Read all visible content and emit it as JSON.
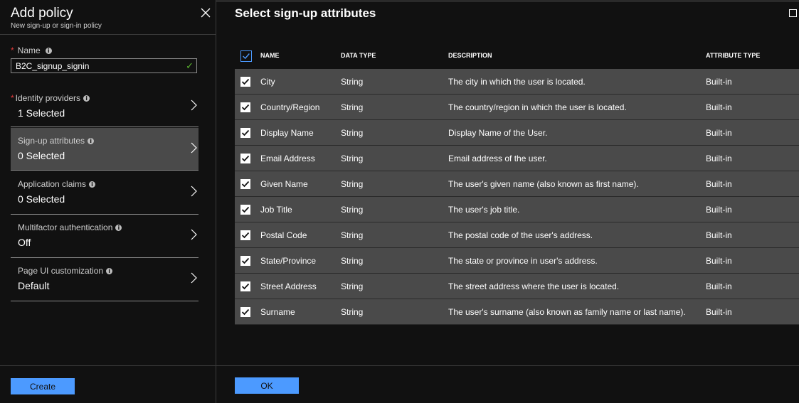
{
  "left": {
    "title": "Add policy",
    "subtitle": "New sign-up or sign-in policy",
    "name_label": "Name",
    "name_required": "*",
    "name_value": "B2C_signup_signin",
    "items": [
      {
        "label": "Identity providers",
        "value": "1 Selected",
        "required": "*"
      },
      {
        "label": "Sign-up attributes",
        "value": "0 Selected",
        "required": ""
      },
      {
        "label": "Application claims",
        "value": "0 Selected",
        "required": ""
      },
      {
        "label": "Multifactor authentication",
        "value": "Off",
        "required": ""
      },
      {
        "label": "Page UI customization",
        "value": "Default",
        "required": ""
      }
    ],
    "create_label": "Create"
  },
  "right": {
    "title": "Select sign-up attributes",
    "headers": {
      "name": "NAME",
      "type": "DATA TYPE",
      "desc": "DESCRIPTION",
      "attr": "ATTRIBUTE TYPE"
    },
    "rows": [
      {
        "name": "City",
        "type": "String",
        "desc": "The city in which the user is located.",
        "attr": "Built-in"
      },
      {
        "name": "Country/Region",
        "type": "String",
        "desc": "The country/region in which the user is located.",
        "attr": "Built-in"
      },
      {
        "name": "Display Name",
        "type": "String",
        "desc": "Display Name of the User.",
        "attr": "Built-in"
      },
      {
        "name": "Email Address",
        "type": "String",
        "desc": "Email address of the user.",
        "attr": "Built-in"
      },
      {
        "name": "Given Name",
        "type": "String",
        "desc": "The user's given name (also known as first name).",
        "attr": "Built-in"
      },
      {
        "name": "Job Title",
        "type": "String",
        "desc": "The user's job title.",
        "attr": "Built-in"
      },
      {
        "name": "Postal Code",
        "type": "String",
        "desc": "The postal code of the user's address.",
        "attr": "Built-in"
      },
      {
        "name": "State/Province",
        "type": "String",
        "desc": "The state or province in user's address.",
        "attr": "Built-in"
      },
      {
        "name": "Street Address",
        "type": "String",
        "desc": "The street address where the user is located.",
        "attr": "Built-in"
      },
      {
        "name": "Surname",
        "type": "String",
        "desc": "The user's surname (also known as family name or last name).",
        "attr": "Built-in"
      }
    ],
    "ok_label": "OK"
  },
  "colors": {
    "accent": "#4c9aff",
    "valid": "#5cb82f",
    "required": "#e23a3a",
    "selected_bg": "#4a4a4a"
  }
}
